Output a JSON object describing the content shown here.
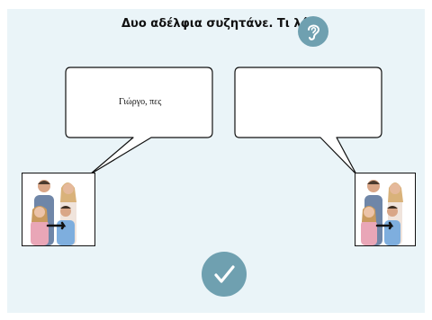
{
  "exercise": {
    "title": "Δυο αδέλφια συζητάνε. Τι λένε",
    "left_bubble_text": "Γιώργο, πες",
    "right_bubble_text": ""
  },
  "icons": {
    "listen": "ear-icon",
    "submit": "checkmark-icon",
    "photo": "family-photo"
  },
  "colors": {
    "background": "#eaf4f8",
    "button": "#6fa0b0"
  }
}
